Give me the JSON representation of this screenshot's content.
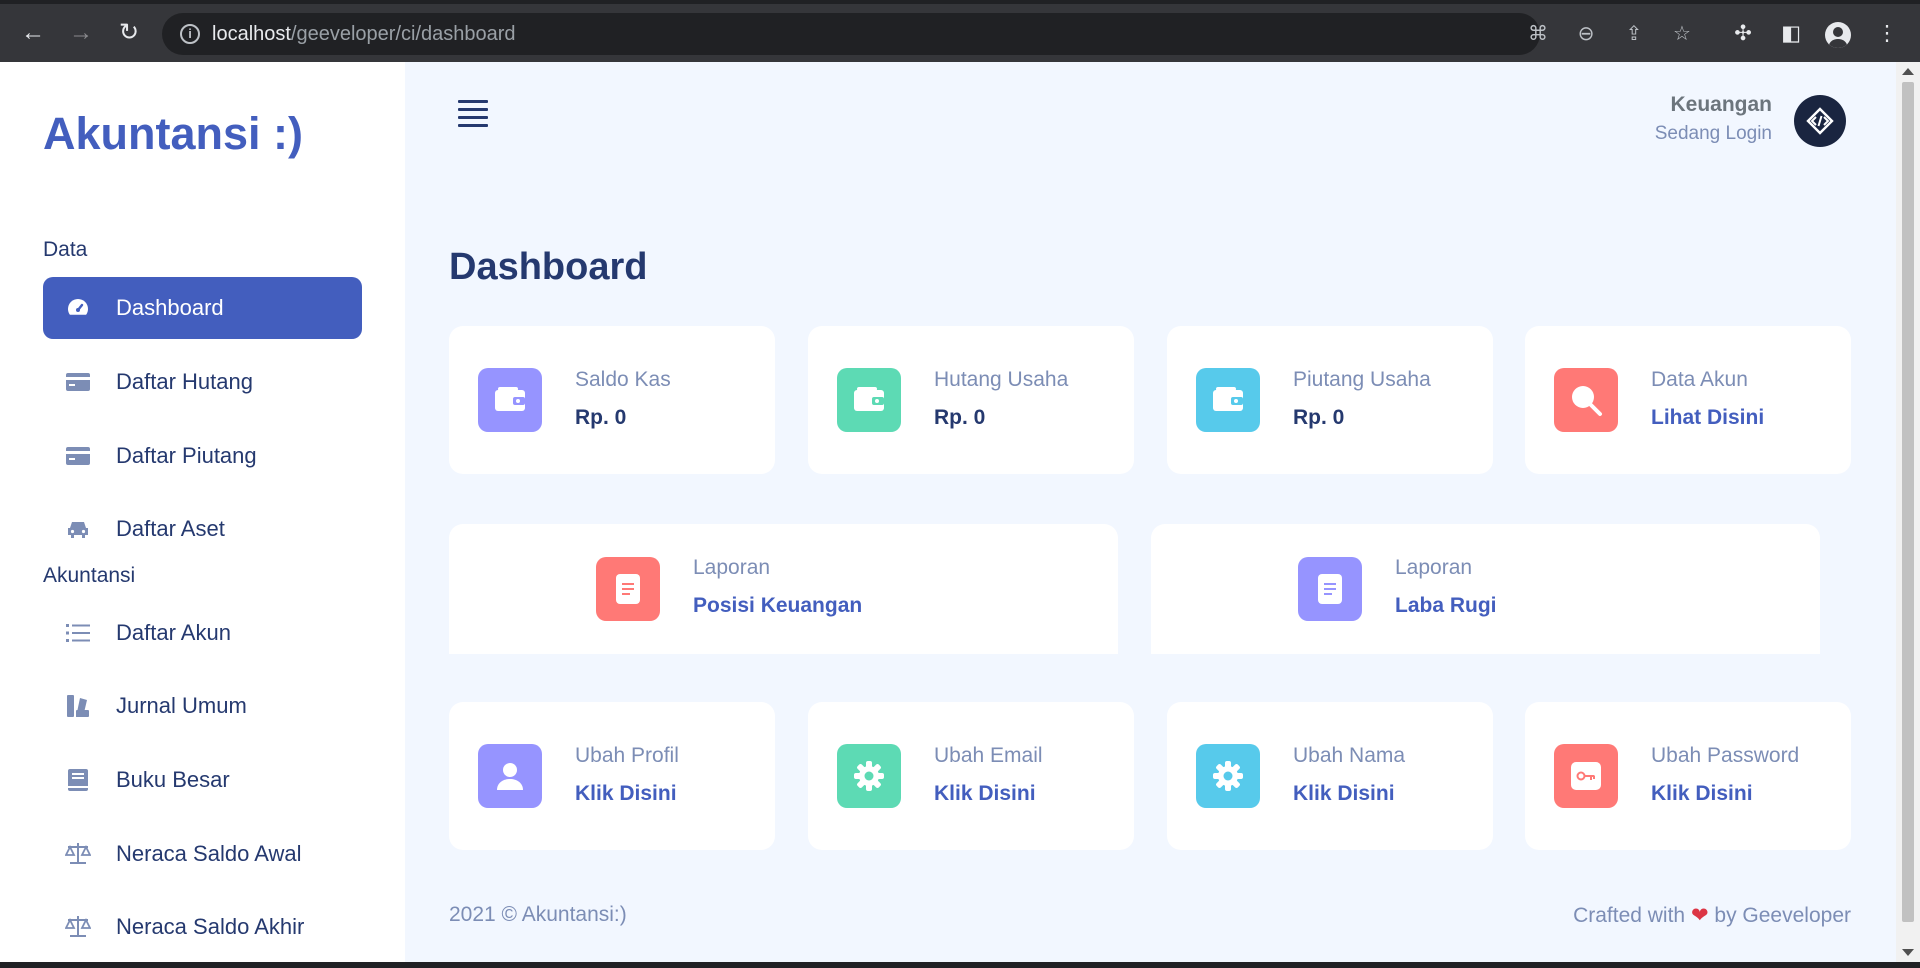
{
  "browser": {
    "url_host": "localhost",
    "url_path": "/geeveloper/ci/dashboard"
  },
  "sidebar": {
    "brand": "Akuntansi :)",
    "sections": [
      {
        "title": "Data",
        "items": [
          {
            "label": "Dashboard",
            "icon": "speedometer-icon",
            "active": true
          },
          {
            "label": "Daftar Hutang",
            "icon": "credit-card-icon"
          },
          {
            "label": "Daftar Piutang",
            "icon": "credit-card-icon"
          },
          {
            "label": "Daftar Aset",
            "icon": "car-icon"
          }
        ]
      },
      {
        "title": "Akuntansi",
        "items": [
          {
            "label": "Daftar Akun",
            "icon": "list-icon"
          },
          {
            "label": "Jurnal Umum",
            "icon": "journal-icon"
          },
          {
            "label": "Buku Besar",
            "icon": "book-icon"
          },
          {
            "label": "Neraca Saldo Awal",
            "icon": "scale-icon"
          },
          {
            "label": "Neraca Saldo Akhir",
            "icon": "scale-icon"
          }
        ]
      }
    ]
  },
  "header": {
    "user_name": "Keuangan",
    "user_status": "Sedang Login"
  },
  "main": {
    "title": "Dashboard",
    "stats": [
      {
        "label": "Saldo Kas",
        "value": "Rp. 0",
        "color": "#9694ff",
        "icon": "wallet-icon"
      },
      {
        "label": "Hutang Usaha",
        "value": "Rp. 0",
        "color": "#5ddab4",
        "icon": "wallet-icon"
      },
      {
        "label": "Piutang Usaha",
        "value": "Rp. 0",
        "color": "#57caeb",
        "icon": "wallet-icon"
      },
      {
        "label": "Data Akun",
        "value": "Lihat Disini",
        "color": "#ff7976",
        "icon": "search-icon"
      }
    ],
    "reports": [
      {
        "label": "Laporan",
        "value": "Posisi Keuangan",
        "color": "#ff7976",
        "icon": "document-icon"
      },
      {
        "label": "Laporan",
        "value": "Laba Rugi",
        "color": "#9694ff",
        "icon": "document-icon"
      }
    ],
    "settings": [
      {
        "label": "Ubah Profil",
        "value": "Klik Disini",
        "color": "#9694ff",
        "icon": "person-icon"
      },
      {
        "label": "Ubah Email",
        "value": "Klik Disini",
        "color": "#5ddab4",
        "icon": "gear-icon"
      },
      {
        "label": "Ubah Nama",
        "value": "Klik Disini",
        "color": "#57caeb",
        "icon": "gear-icon"
      },
      {
        "label": "Ubah Password",
        "value": "Klik Disini",
        "color": "#ff7976",
        "icon": "key-icon"
      }
    ]
  },
  "footer": {
    "left": "2021 © Akuntansi:)",
    "right_prefix": "Crafted with",
    "right_suffix": "by Geeveloper"
  }
}
